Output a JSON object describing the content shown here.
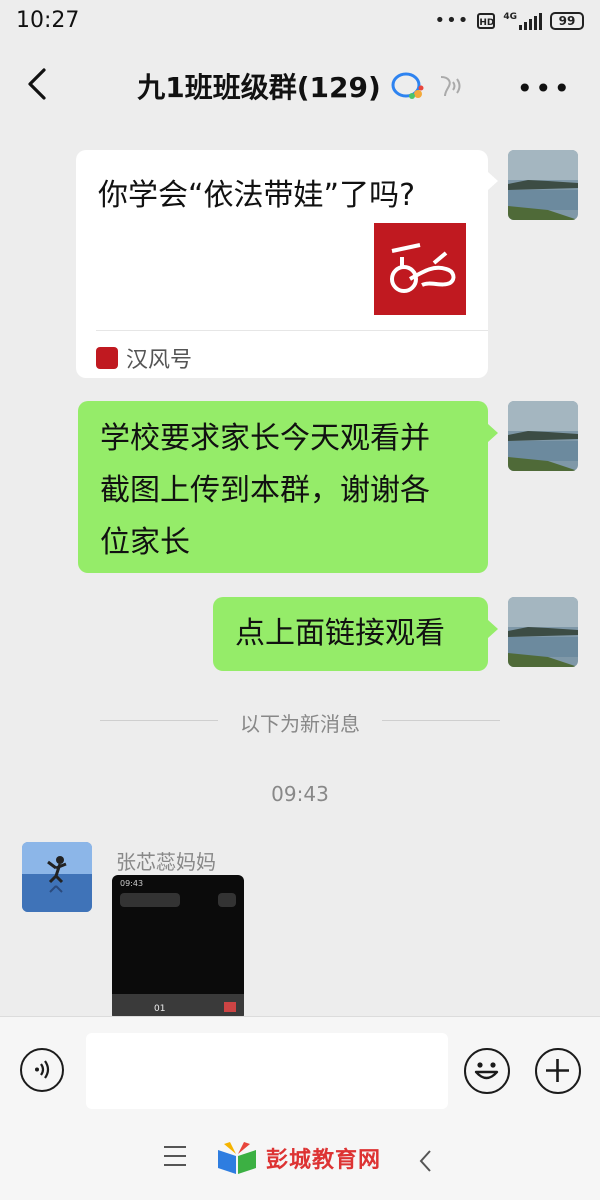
{
  "status_bar": {
    "time": "10:27",
    "network": "4G",
    "hd": "HD",
    "battery": "99"
  },
  "header": {
    "title": "九1班班级群(129)"
  },
  "messages": {
    "card": {
      "title": "你学会“依法带娃”了吗?",
      "source": "汉风号"
    },
    "msg1": {
      "line1": "学校要求家长今天观看并",
      "line2": "截图上传到本群，谢谢各",
      "line3": "位家长"
    },
    "msg2": {
      "text": "点上面链接观看"
    }
  },
  "divider": {
    "label": "以下为新消息"
  },
  "timestamp": "09:43",
  "incoming": {
    "sender": "张芯蕊妈妈",
    "image": {
      "status_time": "09:43",
      "counter": "01"
    }
  },
  "footer": {
    "brand": "彭城教育网"
  },
  "colors": {
    "bubble_green": "#95ec69",
    "background": "#ededed",
    "brand_red": "#c01920"
  }
}
